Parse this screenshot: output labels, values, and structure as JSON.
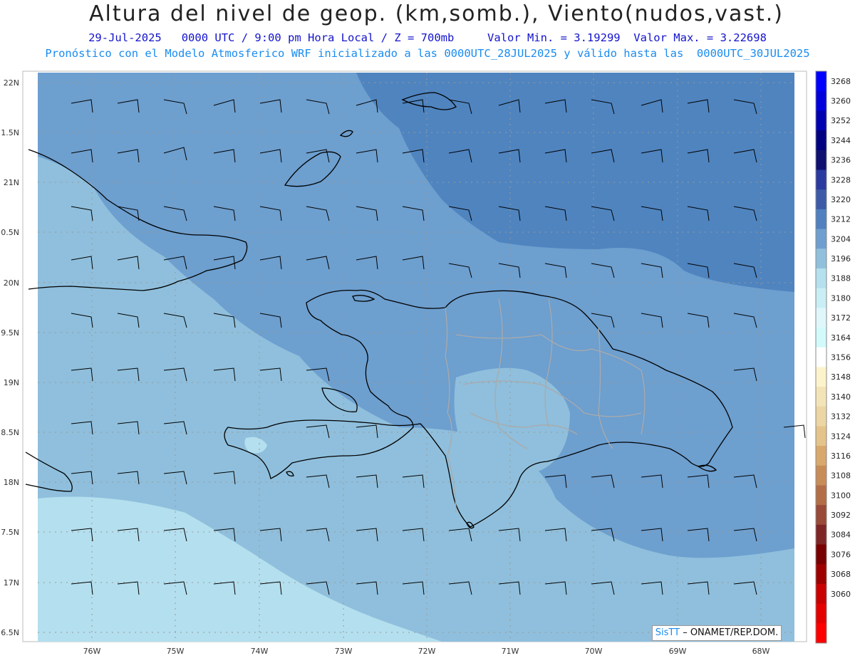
{
  "header": {
    "title": "Altura del nivel de geop. (km,somb.), Viento(nudos,vast.)",
    "info_line": "29-Jul-2025   0000 UTC / 9:00 pm Hora Local / Z = 700mb     Valor Min. = 3.19299  Valor Max. = 3.22698",
    "model_line": "Pronóstico con el Modelo Atmosferico WRF inicializado a las 0000UTC_28JUL2025 y válido hasta las  0000UTC_30JUL2025"
  },
  "map": {
    "lat_labels": [
      "22N",
      "1.5N",
      "21N",
      "0.5N",
      "20N",
      "9.5N",
      "19N",
      "8.5N",
      "18N",
      "7.5N",
      "17N",
      "6.5N"
    ],
    "lon_labels": [
      "76W",
      "75W",
      "74W",
      "73W",
      "72W",
      "71W",
      "70W",
      "69W",
      "68W"
    ],
    "colors": {
      "light": "#b4dfee",
      "mid": "#8fbfdc",
      "med_dark": "#6d9fcf",
      "dark": "#4f84bf",
      "coast": "#000000",
      "border": "#aaaaaa"
    }
  },
  "colorbar": {
    "levels": [
      "3268",
      "3260",
      "3252",
      "3244",
      "3236",
      "3228",
      "3220",
      "3212",
      "3204",
      "3196",
      "3188",
      "3180",
      "3172",
      "3164",
      "3156",
      "3148",
      "3140",
      "3132",
      "3124",
      "3116",
      "3108",
      "3100",
      "3092",
      "3084",
      "3076",
      "3068",
      "3060"
    ],
    "colors": [
      "#0000ff",
      "#0000dd",
      "#0000b0",
      "#000080",
      "#101070",
      "#2a3aa0",
      "#3d5aa8",
      "#5080bf",
      "#6e9fd0",
      "#90c0dc",
      "#b5e0ee",
      "#c9eef5",
      "#dff7fa",
      "#d2fafa",
      "#ffffff",
      "#fcf3cc",
      "#f3e4b8",
      "#ecd6a4",
      "#e4c48a",
      "#d8a86c",
      "#c88c58",
      "#b36e48",
      "#9a4a38",
      "#7e2626",
      "#780000",
      "#9e0000",
      "#c80000",
      "#e50000",
      "#ff0000"
    ]
  },
  "credit": {
    "brand": "SisTT",
    "text": " – ONAMET/REP.DOM."
  }
}
